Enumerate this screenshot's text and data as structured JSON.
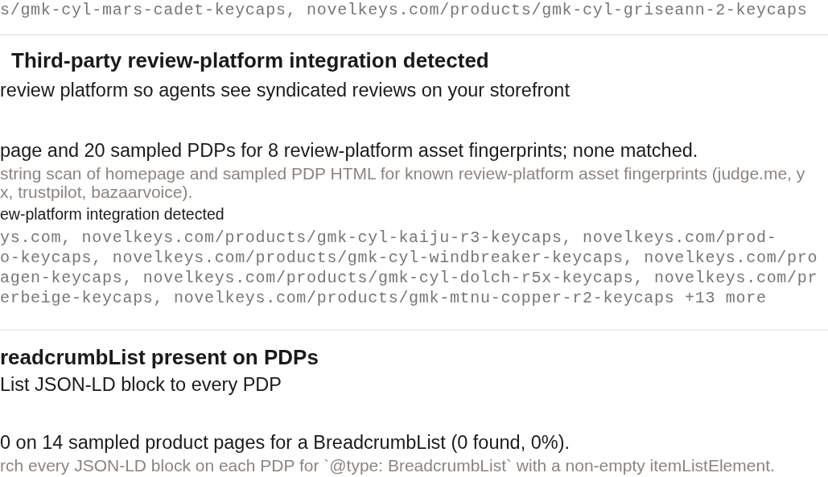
{
  "top_evidence": [
    "s/gmk-cyl-mars-cadet-keycaps, novelkeys.com/products/gmk-cyl-griseann-2-keycaps"
  ],
  "checks": [
    {
      "title": "Third-party review-platform integration detected",
      "subtitle": "review platform so agents see syndicated reviews on your storefront",
      "finding": "page and 20 sampled PDPs for 8 review-platform asset fingerprints; none matched.",
      "method": [
        "string scan of homepage and sampled PDP HTML for known review-platform asset fingerprints (judge.me, y",
        "x, trustpilot, bazaarvoice)."
      ],
      "evidence_label": "ew-platform integration detected",
      "evidence": [
        "ys.com, novelkeys.com/products/gmk-cyl-kaiju-r3-keycaps, novelkeys.com/prod-",
        "o-keycaps, novelkeys.com/products/gmk-cyl-windbreaker-keycaps, novelkeys.com/pro",
        "agen-keycaps, novelkeys.com/products/gmk-cyl-dolch-r5x-keycaps, novelkeys.com/pr",
        "erbeige-keycaps, novelkeys.com/products/gmk-mtnu-copper-r2-keycaps +13 more"
      ]
    },
    {
      "title": "readcrumbList present on PDPs",
      "subtitle": "List JSON-LD block to every PDP",
      "finding": "0 on 14 sampled product pages for a BreadcrumbList (0 found, 0%).",
      "method": [
        "rch every JSON-LD block on each PDP for `@type: BreadcrumbList` with a non-empty itemListElement."
      ]
    }
  ]
}
